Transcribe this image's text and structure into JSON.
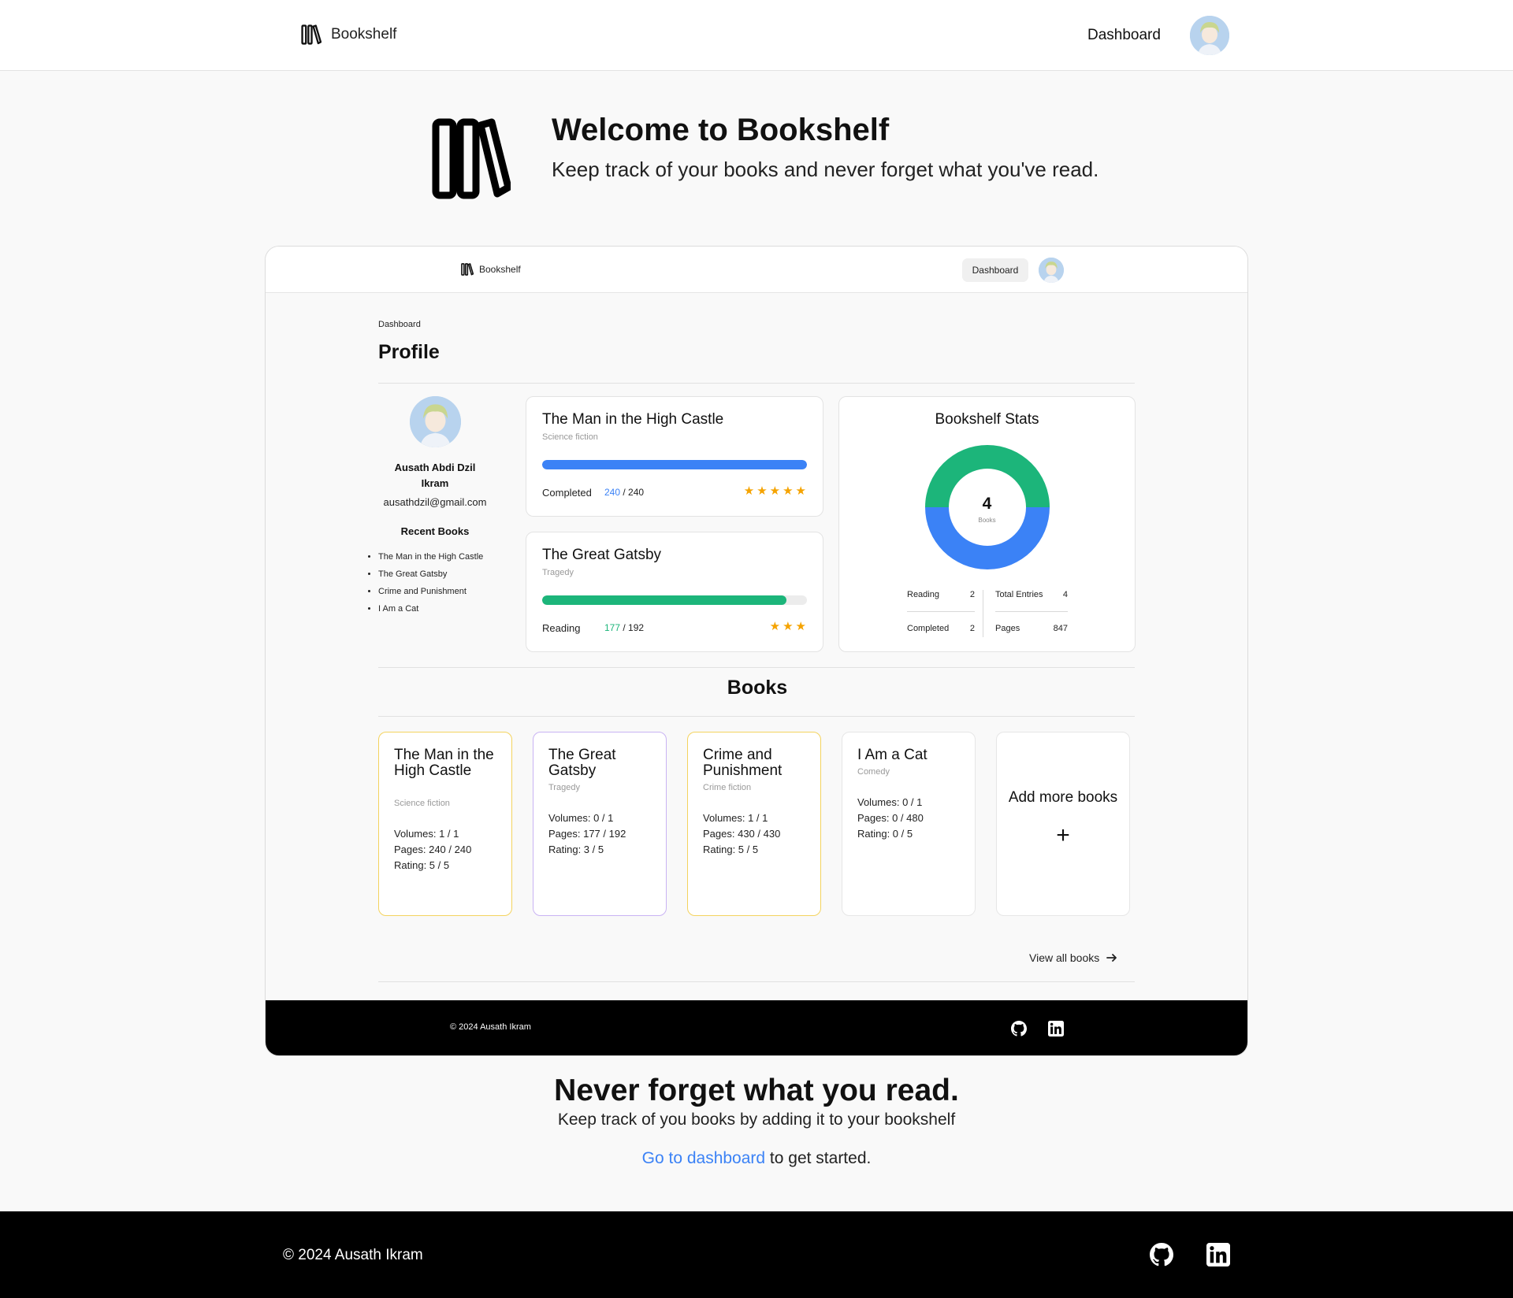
{
  "nav": {
    "brand": "Bookshelf",
    "dashboard": "Dashboard"
  },
  "hero": {
    "title": "Welcome to Bookshelf",
    "subtitle": "Keep track of your books and never forget what you've read."
  },
  "preview": {
    "nav": {
      "brand": "Bookshelf",
      "dashboard": "Dashboard"
    },
    "breadcrumb": "Dashboard",
    "profile_title": "Profile",
    "user": {
      "name": "Ausath Abdi Dzil Ikram",
      "email": "ausathdzil@gmail.com",
      "recent_heading": "Recent Books",
      "recent_books": [
        "The Man in the High Castle",
        "The Great Gatsby",
        "Crime and Punishment",
        "I Am a Cat"
      ]
    },
    "progress_cards": [
      {
        "title": "The Man in the High Castle",
        "genre": "Science fiction",
        "status": "Completed",
        "read": "240",
        "total": "240",
        "progress": 1.0,
        "bar_color": "#3b82f6",
        "read_color": "#3b82f6",
        "rating": 5
      },
      {
        "title": "The Great Gatsby",
        "genre": "Tragedy",
        "status": "Reading",
        "read": "177",
        "total": "192",
        "progress": 0.922,
        "bar_color": "#1cb57a",
        "read_color": "#1cb57a",
        "rating": 3
      }
    ],
    "stats": {
      "title": "Bookshelf Stats",
      "count": "4",
      "unit": "Books",
      "reading_label": "Reading",
      "reading": "2",
      "completed_label": "Completed",
      "completed": "2",
      "total_label": "Total Entries",
      "total": "4",
      "pages_label": "Pages",
      "pages": "847",
      "reading_color": "#1cb57a",
      "completed_color": "#3b82f6"
    },
    "books_title": "Books",
    "books": [
      {
        "title": "The Man in the High Castle",
        "genre": "Science fiction",
        "volumes": "Volumes: 1 / 1",
        "pages": "Pages: 240 / 240",
        "rating": "Rating: 5 / 5",
        "border": "#f4d35e"
      },
      {
        "title": "The Great Gatsby",
        "genre": "Tragedy",
        "volumes": "Volumes: 0 / 1",
        "pages": "Pages: 177 / 192",
        "rating": "Rating: 3 / 5",
        "border": "#c9b3f3"
      },
      {
        "title": "Crime and Punishment",
        "genre": "Crime fiction",
        "volumes": "Volumes: 1 / 1",
        "pages": "Pages: 430 / 430",
        "rating": "Rating: 5 / 5",
        "border": "#f4d35e"
      },
      {
        "title": "I Am a Cat",
        "genre": "Comedy",
        "volumes": "Volumes: 0 / 1",
        "pages": "Pages: 0 / 480",
        "rating": "Rating: 0 / 5",
        "border": "#e6e6e6"
      }
    ],
    "add_more": "Add more books",
    "add_icon": "+",
    "view_all": "View all books",
    "footer_copy": "© 2024 Ausath Ikram"
  },
  "cta": {
    "title": "Never forget what you read.",
    "subtitle": "Keep track of you books by adding it to your bookshelf",
    "link": "Go to dashboard",
    "suffix": " to get started."
  },
  "footer": {
    "copy": "© 2024 Ausath Ikram"
  },
  "icons": [
    "bookshelf-logo-icon",
    "github-icon",
    "linkedin-icon",
    "arrow-right-icon",
    "star-icon",
    "plus-icon"
  ]
}
